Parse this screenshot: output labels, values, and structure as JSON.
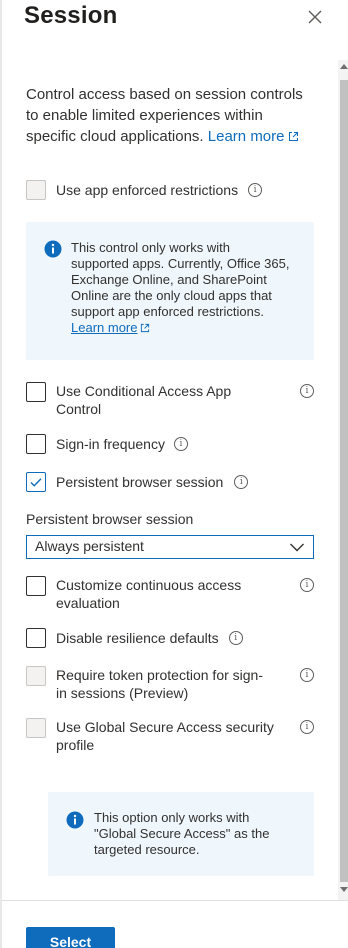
{
  "header": {
    "title": "Session"
  },
  "description": {
    "text": "Control access based on session controls to enable limited experiences within specific cloud applications.",
    "learn_more": "Learn more"
  },
  "options": {
    "app_enforced": {
      "label": "Use app enforced restrictions",
      "checked": false,
      "disabled": true
    },
    "cond_access_app": {
      "label_line1": "Use Conditional Access App",
      "label_line2": "Control",
      "checked": false
    },
    "signin_frequency": {
      "label": "Sign-in frequency",
      "checked": false
    },
    "persistent_session": {
      "label": "Persistent browser session",
      "checked": true
    },
    "continuous_eval": {
      "label_line1": "Customize continuous access",
      "label_line2": "evaluation",
      "checked": false
    },
    "resilience": {
      "label": "Disable resilience defaults",
      "checked": false
    },
    "token_protection": {
      "label_line1": "Require token protection for sign-",
      "label_line2": "in sessions (Preview)",
      "checked": false,
      "disabled": true
    },
    "gsa_profile": {
      "label_line1": "Use Global Secure Access security",
      "label_line2": "profile",
      "checked": false,
      "disabled": true
    }
  },
  "info_app_enforced": {
    "lines": [
      "This control only works with",
      "supported apps. Currently, Office 365,",
      "Exchange Online, and SharePoint",
      "Online are the only cloud apps that",
      "support app enforced restrictions."
    ],
    "learn_more": "Learn more"
  },
  "persistent_field": {
    "label": "Persistent browser session",
    "value": "Always persistent"
  },
  "info_gsa": {
    "lines": [
      "This option only works with",
      "\"Global Secure Access\" as the",
      "targeted resource."
    ]
  },
  "footer": {
    "select_label": "Select"
  },
  "colors": {
    "accent": "#0f6cbd",
    "info_bg": "#eff6fc"
  }
}
